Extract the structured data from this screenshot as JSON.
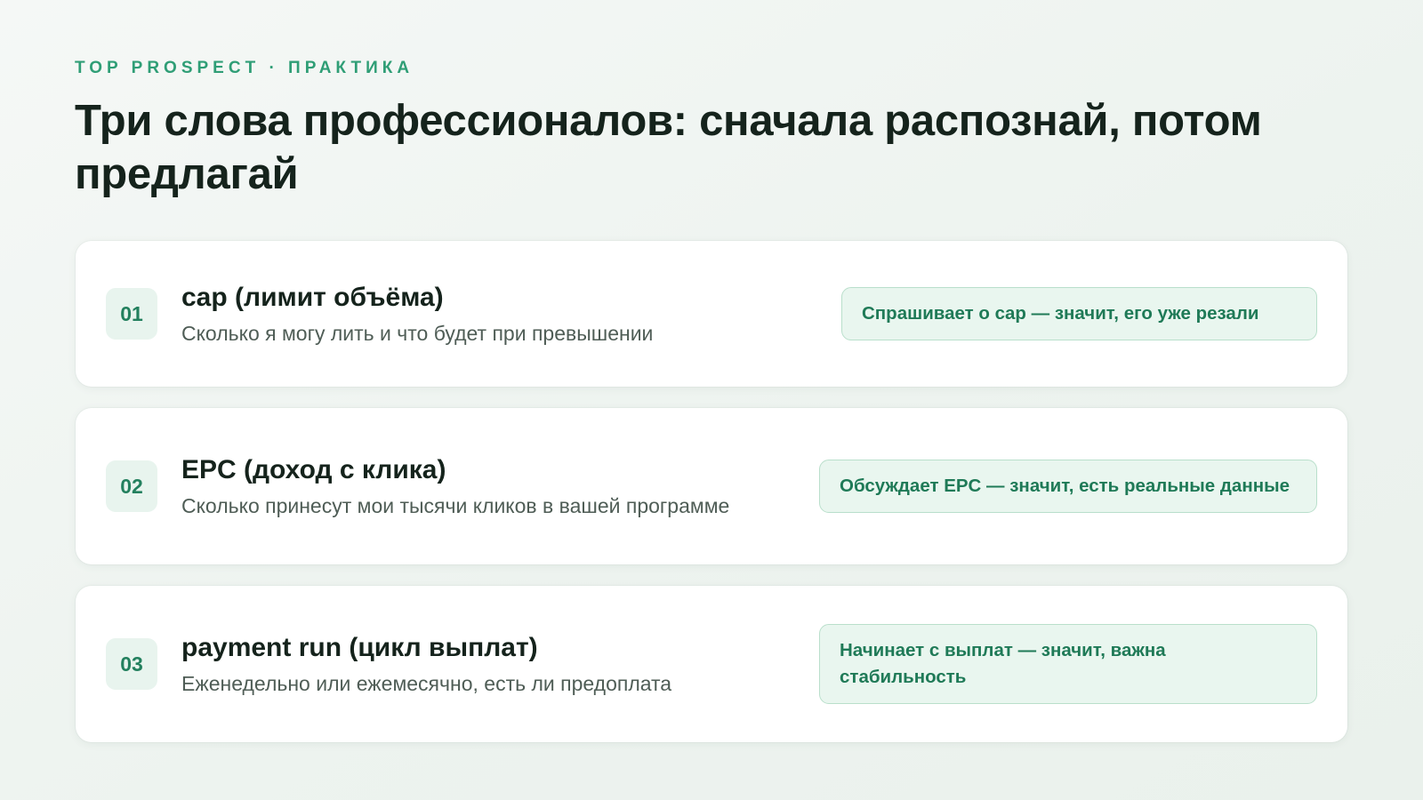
{
  "slide": {
    "eyebrow": "TOP PROSPECT · ПРАКТИКА",
    "title": "Три слова профессионалов: сначала распознай, потом предлагай"
  },
  "cards": [
    {
      "number": "01",
      "term": "cap (лимит объёма)",
      "description": "Сколько я могу лить и что будет при превышении",
      "note": "Спрашивает о cap — значит, его уже резали"
    },
    {
      "number": "02",
      "term": "EPC (доход с клика)",
      "description": "Сколько принесут мои тысячи кликов в вашей программе",
      "note": "Обсуждает EPC — значит, есть реальные данные"
    },
    {
      "number": "03",
      "term": "payment run (цикл выплат)",
      "description": "Еженедельно или ежемесячно, есть ли предоплата",
      "note": "Начинает с выплат — значит, важна стабильность"
    }
  ],
  "colors": {
    "accent": "#2f9e76",
    "title": "#15231c",
    "badge_bg": "#e8f4ee",
    "note_bg": "#e9f6ef",
    "note_border": "#b9dfcb"
  }
}
